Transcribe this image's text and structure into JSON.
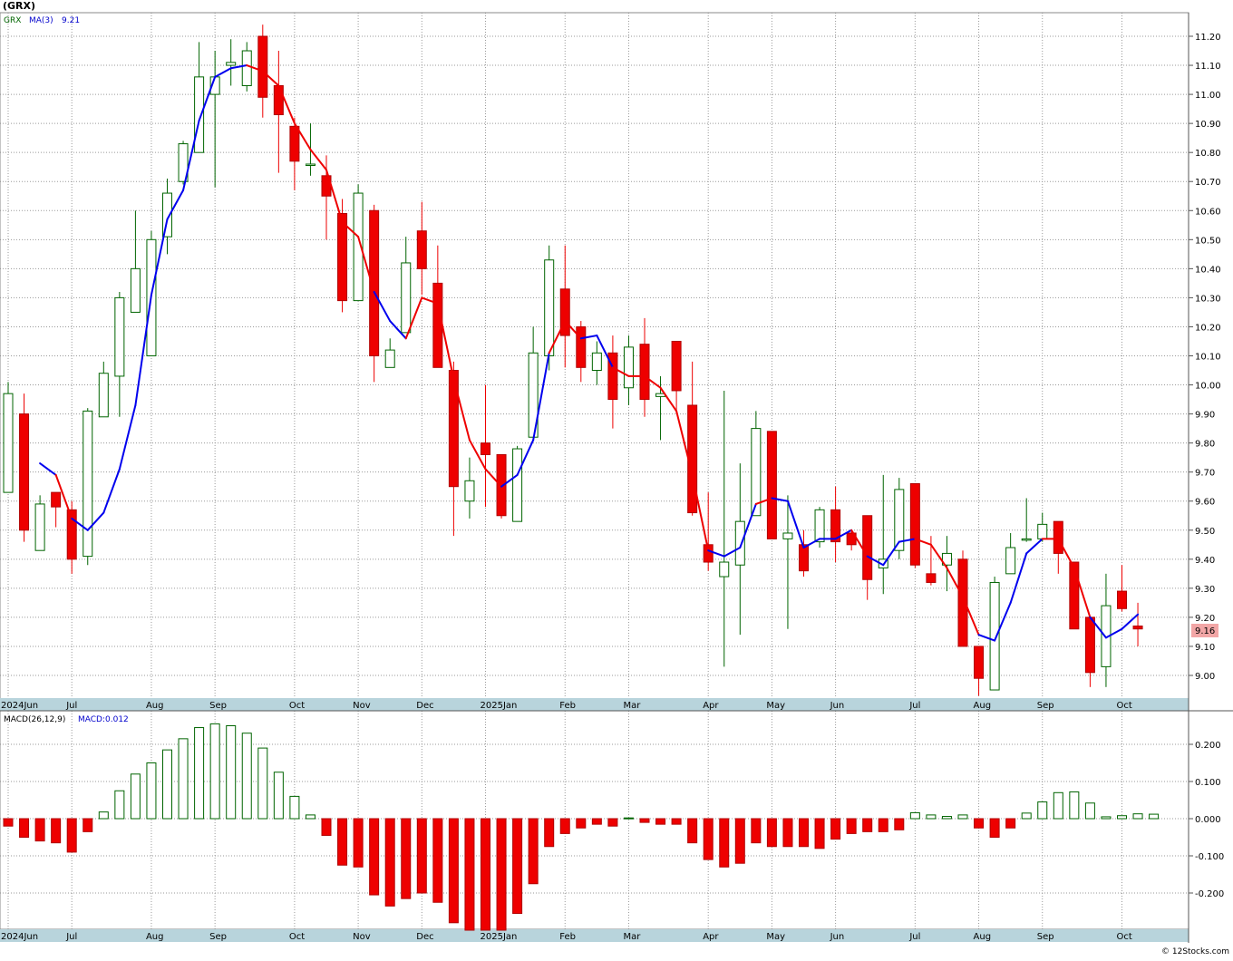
{
  "header": {
    "symbol": "(GRX)"
  },
  "price_legend": {
    "symbol": "GRX",
    "ma_label": "MA(3)",
    "ma_value": "9.21"
  },
  "macd_legend": {
    "params": "MACD(26,12,9)",
    "value_label": "MACD:0.012"
  },
  "last_price": "9.16",
  "credit": "© 12Stocks.com",
  "colors": {
    "up": "#006400",
    "down": "#ee0000",
    "ma_up": "#0000ee",
    "ma_down": "#ee0000",
    "grid": "#9a9a9a",
    "axis_band": "#b8d4dc",
    "price_tag": "#f2a6a6"
  },
  "chart_data": [
    {
      "type": "candlestick",
      "interval": "weekly",
      "y_ticks": [
        "9.00",
        "9.10",
        "9.20",
        "9.30",
        "9.40",
        "9.50",
        "9.60",
        "9.70",
        "9.80",
        "9.90",
        "10.00",
        "10.10",
        "10.20",
        "10.30",
        "10.40",
        "10.50",
        "10.60",
        "10.70",
        "10.80",
        "10.90",
        "11.00",
        "11.10",
        "11.20"
      ],
      "ylim": [
        8.92,
        11.25
      ],
      "x_labels": [
        "2024Jun",
        "Jul",
        "Aug",
        "Sep",
        "Oct",
        "Nov",
        "Dec",
        "2025Jan",
        "Feb",
        "Mar",
        "Apr",
        "May",
        "Jun",
        "Jul",
        "Aug",
        "Sep",
        "Oct"
      ],
      "x_label_weeks": [
        0,
        4,
        9,
        13,
        18,
        22,
        26,
        30,
        35,
        39,
        44,
        48,
        52,
        57,
        61,
        65,
        70
      ],
      "candles": [
        {
          "o": 9.63,
          "h": 10.01,
          "l": 9.63,
          "c": 9.97
        },
        {
          "o": 9.9,
          "h": 9.97,
          "l": 9.46,
          "c": 9.5
        },
        {
          "o": 9.43,
          "h": 9.62,
          "l": 9.43,
          "c": 9.59
        },
        {
          "o": 9.63,
          "h": 9.63,
          "l": 9.51,
          "c": 9.58
        },
        {
          "o": 9.57,
          "h": 9.6,
          "l": 9.35,
          "c": 9.4
        },
        {
          "o": 9.41,
          "h": 9.92,
          "l": 9.38,
          "c": 9.91
        },
        {
          "o": 9.89,
          "h": 10.08,
          "l": 9.89,
          "c": 10.04
        },
        {
          "o": 10.03,
          "h": 10.32,
          "l": 9.89,
          "c": 10.3
        },
        {
          "o": 10.25,
          "h": 10.6,
          "l": 10.25,
          "c": 10.4
        },
        {
          "o": 10.1,
          "h": 10.53,
          "l": 10.1,
          "c": 10.5
        },
        {
          "o": 10.51,
          "h": 10.71,
          "l": 10.45,
          "c": 10.66
        },
        {
          "o": 10.7,
          "h": 10.84,
          "l": 10.69,
          "c": 10.83
        },
        {
          "o": 10.8,
          "h": 11.18,
          "l": 10.8,
          "c": 11.06
        },
        {
          "o": 11.0,
          "h": 11.15,
          "l": 10.68,
          "c": 11.06
        },
        {
          "o": 11.1,
          "h": 11.19,
          "l": 11.03,
          "c": 11.11
        },
        {
          "o": 11.03,
          "h": 11.18,
          "l": 11.01,
          "c": 11.15
        },
        {
          "o": 11.2,
          "h": 11.24,
          "l": 10.92,
          "c": 10.99
        },
        {
          "o": 11.03,
          "h": 11.15,
          "l": 10.73,
          "c": 10.93
        },
        {
          "o": 10.89,
          "h": 10.92,
          "l": 10.67,
          "c": 10.77
        },
        {
          "o": 10.76,
          "h": 10.9,
          "l": 10.72,
          "c": 10.76
        },
        {
          "o": 10.72,
          "h": 10.79,
          "l": 10.5,
          "c": 10.65
        },
        {
          "o": 10.59,
          "h": 10.64,
          "l": 10.25,
          "c": 10.29
        },
        {
          "o": 10.29,
          "h": 10.69,
          "l": 10.29,
          "c": 10.66
        },
        {
          "o": 10.6,
          "h": 10.62,
          "l": 10.01,
          "c": 10.1
        },
        {
          "o": 10.06,
          "h": 10.16,
          "l": 10.06,
          "c": 10.12
        },
        {
          "o": 10.18,
          "h": 10.51,
          "l": 10.18,
          "c": 10.42
        },
        {
          "o": 10.53,
          "h": 10.63,
          "l": 10.31,
          "c": 10.4
        },
        {
          "o": 10.35,
          "h": 10.48,
          "l": 10.06,
          "c": 10.06
        },
        {
          "o": 10.05,
          "h": 10.08,
          "l": 9.48,
          "c": 9.65
        },
        {
          "o": 9.6,
          "h": 9.75,
          "l": 9.54,
          "c": 9.67
        },
        {
          "o": 9.8,
          "h": 10.0,
          "l": 9.58,
          "c": 9.76
        },
        {
          "o": 9.76,
          "h": 9.76,
          "l": 9.54,
          "c": 9.55
        },
        {
          "o": 9.53,
          "h": 9.79,
          "l": 9.53,
          "c": 9.78
        },
        {
          "o": 9.82,
          "h": 10.2,
          "l": 9.82,
          "c": 10.11
        },
        {
          "o": 10.1,
          "h": 10.48,
          "l": 10.05,
          "c": 10.43
        },
        {
          "o": 10.33,
          "h": 10.48,
          "l": 10.06,
          "c": 10.17
        },
        {
          "o": 10.2,
          "h": 10.22,
          "l": 10.01,
          "c": 10.06
        },
        {
          "o": 10.05,
          "h": 10.15,
          "l": 10.0,
          "c": 10.11
        },
        {
          "o": 10.11,
          "h": 10.17,
          "l": 9.85,
          "c": 9.95
        },
        {
          "o": 9.99,
          "h": 10.17,
          "l": 9.93,
          "c": 10.13
        },
        {
          "o": 10.14,
          "h": 10.23,
          "l": 9.89,
          "c": 9.95
        },
        {
          "o": 9.96,
          "h": 10.03,
          "l": 9.81,
          "c": 9.97
        },
        {
          "o": 10.15,
          "h": 10.15,
          "l": 9.9,
          "c": 9.98
        },
        {
          "o": 9.93,
          "h": 10.08,
          "l": 9.55,
          "c": 9.56
        },
        {
          "o": 9.45,
          "h": 9.63,
          "l": 9.36,
          "c": 9.39
        },
        {
          "o": 9.34,
          "h": 9.98,
          "l": 9.03,
          "c": 9.39
        },
        {
          "o": 9.38,
          "h": 9.73,
          "l": 9.14,
          "c": 9.53
        },
        {
          "o": 9.55,
          "h": 9.91,
          "l": 9.55,
          "c": 9.85
        },
        {
          "o": 9.84,
          "h": 9.84,
          "l": 9.47,
          "c": 9.47
        },
        {
          "o": 9.47,
          "h": 9.62,
          "l": 9.16,
          "c": 9.49
        },
        {
          "o": 9.45,
          "h": 9.5,
          "l": 9.34,
          "c": 9.36
        },
        {
          "o": 9.46,
          "h": 9.58,
          "l": 9.44,
          "c": 9.57
        },
        {
          "o": 9.57,
          "h": 9.65,
          "l": 9.39,
          "c": 9.46
        },
        {
          "o": 9.49,
          "h": 9.5,
          "l": 9.43,
          "c": 9.45
        },
        {
          "o": 9.55,
          "h": 9.55,
          "l": 9.26,
          "c": 9.33
        },
        {
          "o": 9.37,
          "h": 9.69,
          "l": 9.28,
          "c": 9.4
        },
        {
          "o": 9.43,
          "h": 9.68,
          "l": 9.4,
          "c": 9.64
        },
        {
          "o": 9.66,
          "h": 9.66,
          "l": 9.37,
          "c": 9.38
        },
        {
          "o": 9.35,
          "h": 9.48,
          "l": 9.31,
          "c": 9.32
        },
        {
          "o": 9.38,
          "h": 9.48,
          "l": 9.29,
          "c": 9.42
        },
        {
          "o": 9.4,
          "h": 9.43,
          "l": 9.1,
          "c": 9.1
        },
        {
          "o": 9.1,
          "h": 9.1,
          "l": 8.93,
          "c": 8.99
        },
        {
          "o": 8.95,
          "h": 9.34,
          "l": 8.95,
          "c": 9.32
        },
        {
          "o": 9.35,
          "h": 9.49,
          "l": 9.35,
          "c": 9.44
        },
        {
          "o": 9.47,
          "h": 9.61,
          "l": 9.46,
          "c": 9.47
        },
        {
          "o": 9.47,
          "h": 9.56,
          "l": 9.46,
          "c": 9.52
        },
        {
          "o": 9.53,
          "h": 9.53,
          "l": 9.35,
          "c": 9.42
        },
        {
          "o": 9.39,
          "h": 9.39,
          "l": 9.16,
          "c": 9.16
        },
        {
          "o": 9.2,
          "h": 9.2,
          "l": 8.96,
          "c": 9.01
        },
        {
          "o": 9.03,
          "h": 9.35,
          "l": 8.96,
          "c": 9.24
        },
        {
          "o": 9.29,
          "h": 9.38,
          "l": 9.22,
          "c": 9.23
        },
        {
          "o": 9.17,
          "h": 9.25,
          "l": 9.1,
          "c": 9.16
        }
      ],
      "ma3": [
        null,
        null,
        9.73,
        9.69,
        9.54,
        9.5,
        9.56,
        9.71,
        9.93,
        10.31,
        10.57,
        10.67,
        10.91,
        11.06,
        11.09,
        11.1,
        11.08,
        11.03,
        10.9,
        10.81,
        10.74,
        10.56,
        10.51,
        10.32,
        10.22,
        10.16,
        10.3,
        10.28,
        10.02,
        9.81,
        9.71,
        9.65,
        9.69,
        9.81,
        10.11,
        10.22,
        10.16,
        10.17,
        10.06,
        10.03,
        10.03,
        9.99,
        9.91,
        9.69,
        9.43,
        9.41,
        9.44,
        9.59,
        9.61,
        9.6,
        9.44,
        9.47,
        9.47,
        9.5,
        9.41,
        9.38,
        9.46,
        9.47,
        9.45,
        9.37,
        9.27,
        9.14,
        9.12,
        9.25,
        9.42,
        9.47,
        9.47,
        9.37,
        9.2,
        9.13,
        9.16,
        9.21
      ],
      "ma3_trend": [
        "up",
        "up",
        "up",
        "up",
        "down",
        "up",
        "up",
        "up",
        "up",
        "up",
        "up",
        "up",
        "up",
        "up",
        "up",
        "up",
        "down",
        "down",
        "down",
        "down",
        "down",
        "down",
        "down",
        "down",
        "up",
        "up",
        "down",
        "down",
        "down",
        "down",
        "down",
        "down",
        "up",
        "up",
        "up",
        "down",
        "down",
        "up",
        "up",
        "down",
        "down",
        "down",
        "down",
        "down",
        "down",
        "up",
        "up",
        "up",
        "down",
        "up",
        "up",
        "up",
        "up",
        "up",
        "down",
        "up",
        "up",
        "up",
        "down",
        "down",
        "down",
        "down",
        "up",
        "up",
        "up",
        "up",
        "down",
        "down",
        "down",
        "up",
        "up",
        "up"
      ]
    },
    {
      "type": "bar",
      "title": "MACD(26,12,9)",
      "y_ticks": [
        "-0.200",
        "-0.100",
        "0.000",
        "0.100",
        "0.200"
      ],
      "ylim": [
        -0.3,
        0.28
      ],
      "values": [
        -0.02,
        -0.05,
        -0.06,
        -0.065,
        -0.09,
        -0.035,
        0.018,
        0.075,
        0.12,
        0.15,
        0.185,
        0.215,
        0.245,
        0.255,
        0.25,
        0.23,
        0.19,
        0.125,
        0.06,
        0.01,
        -0.045,
        -0.125,
        -0.13,
        -0.205,
        -0.235,
        -0.215,
        -0.2,
        -0.225,
        -0.28,
        -0.3,
        -0.3,
        -0.3,
        -0.255,
        -0.175,
        -0.075,
        -0.04,
        -0.025,
        -0.015,
        -0.02,
        0.002,
        -0.01,
        -0.015,
        -0.015,
        -0.065,
        -0.11,
        -0.13,
        -0.12,
        -0.065,
        -0.075,
        -0.075,
        -0.075,
        -0.08,
        -0.055,
        -0.04,
        -0.035,
        -0.035,
        -0.03,
        0.016,
        0.01,
        0.006,
        0.01,
        -0.025,
        -0.05,
        -0.025,
        0.015,
        0.045,
        0.07,
        0.072,
        0.042,
        0.005,
        0.008,
        0.013,
        0.012
      ]
    }
  ]
}
